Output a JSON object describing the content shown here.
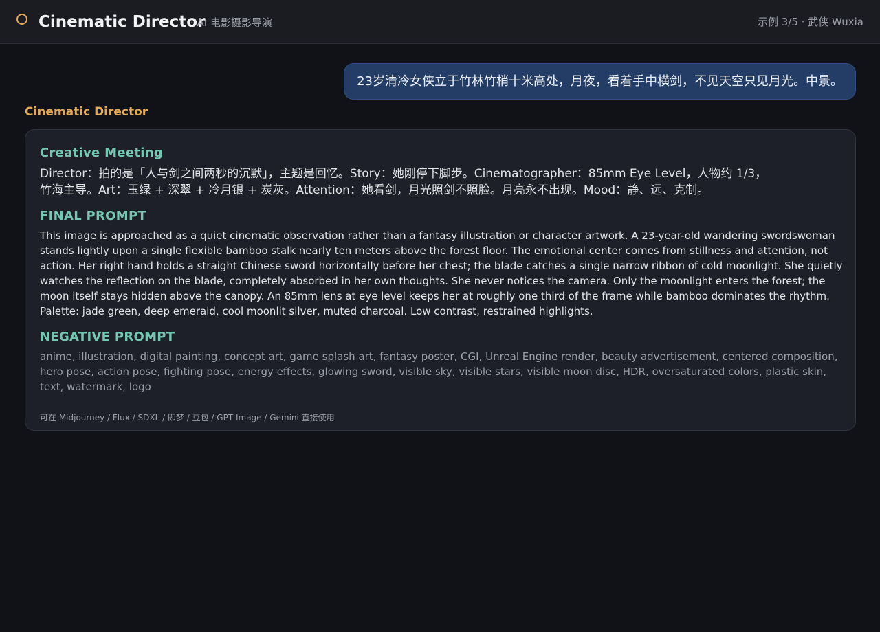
{
  "header": {
    "title": "Cinematic Director",
    "subtitle": "· AI 电影摄影导演",
    "example_indicator": "示例 3/5 · 武侠 Wuxia",
    "logo_icon": "circle-ring-icon",
    "accent_color": "#e3a953"
  },
  "chat": {
    "user_message": "23岁清冷女侠立于竹林竹梢十米高处，月夜，看着手中横剑，不见天空只见月光。中景。",
    "assistant_name": "Cinematic Director",
    "response": {
      "meeting_heading": "Creative Meeting",
      "meeting_text": "Director：拍的是「人与剑之间两秒的沉默」，主题是回忆。Story：她刚停下脚步。Cinematographer：85mm Eye Level，人物约 1/3，竹海主导。Art：玉绿 + 深翠 + 冷月银 + 炭灰。Attention：她看剑，月光照剑不照脸。月亮永不出现。Mood：静、远、克制。",
      "final_heading": "FINAL PROMPT",
      "final_text": "This image is approached as a quiet cinematic observation rather than a fantasy illustration or character artwork. A 23-year-old wandering swordswoman stands lightly upon a single flexible bamboo stalk nearly ten meters above the forest floor. The emotional center comes from stillness and attention, not action. Her right hand holds a straight Chinese sword horizontally before her chest; the blade catches a single narrow ribbon of cold moonlight. She quietly watches the reflection on the blade, completely absorbed in her own thoughts. She never notices the camera. Only the moonlight enters the forest; the moon itself stays hidden above the canopy. An 85mm lens at eye level keeps her at roughly one third of the frame while bamboo dominates the rhythm. Palette: jade green, deep emerald, cool moonlit silver, muted charcoal. Low contrast, restrained highlights.",
      "negative_heading": "NEGATIVE PROMPT",
      "negative_text": "anime, illustration, digital painting, concept art, game splash art, fantasy poster, CGI, Unreal Engine render, beauty advertisement, centered composition, hero pose, action pose, fighting pose, energy effects, glowing sword, visible sky, visible stars, visible moon disc, HDR, oversaturated colors, plastic skin, text, watermark, logo",
      "usage_note": "可在 Midjourney / Flux / SDXL / 即梦 / 豆包 / GPT Image / Gemini 直接使用"
    }
  },
  "colors": {
    "background": "#111217",
    "header_bg": "#1b1c21",
    "user_bubble": "#233d67",
    "card_bg": "#1e2029",
    "heading_teal": "#74c7b3"
  }
}
